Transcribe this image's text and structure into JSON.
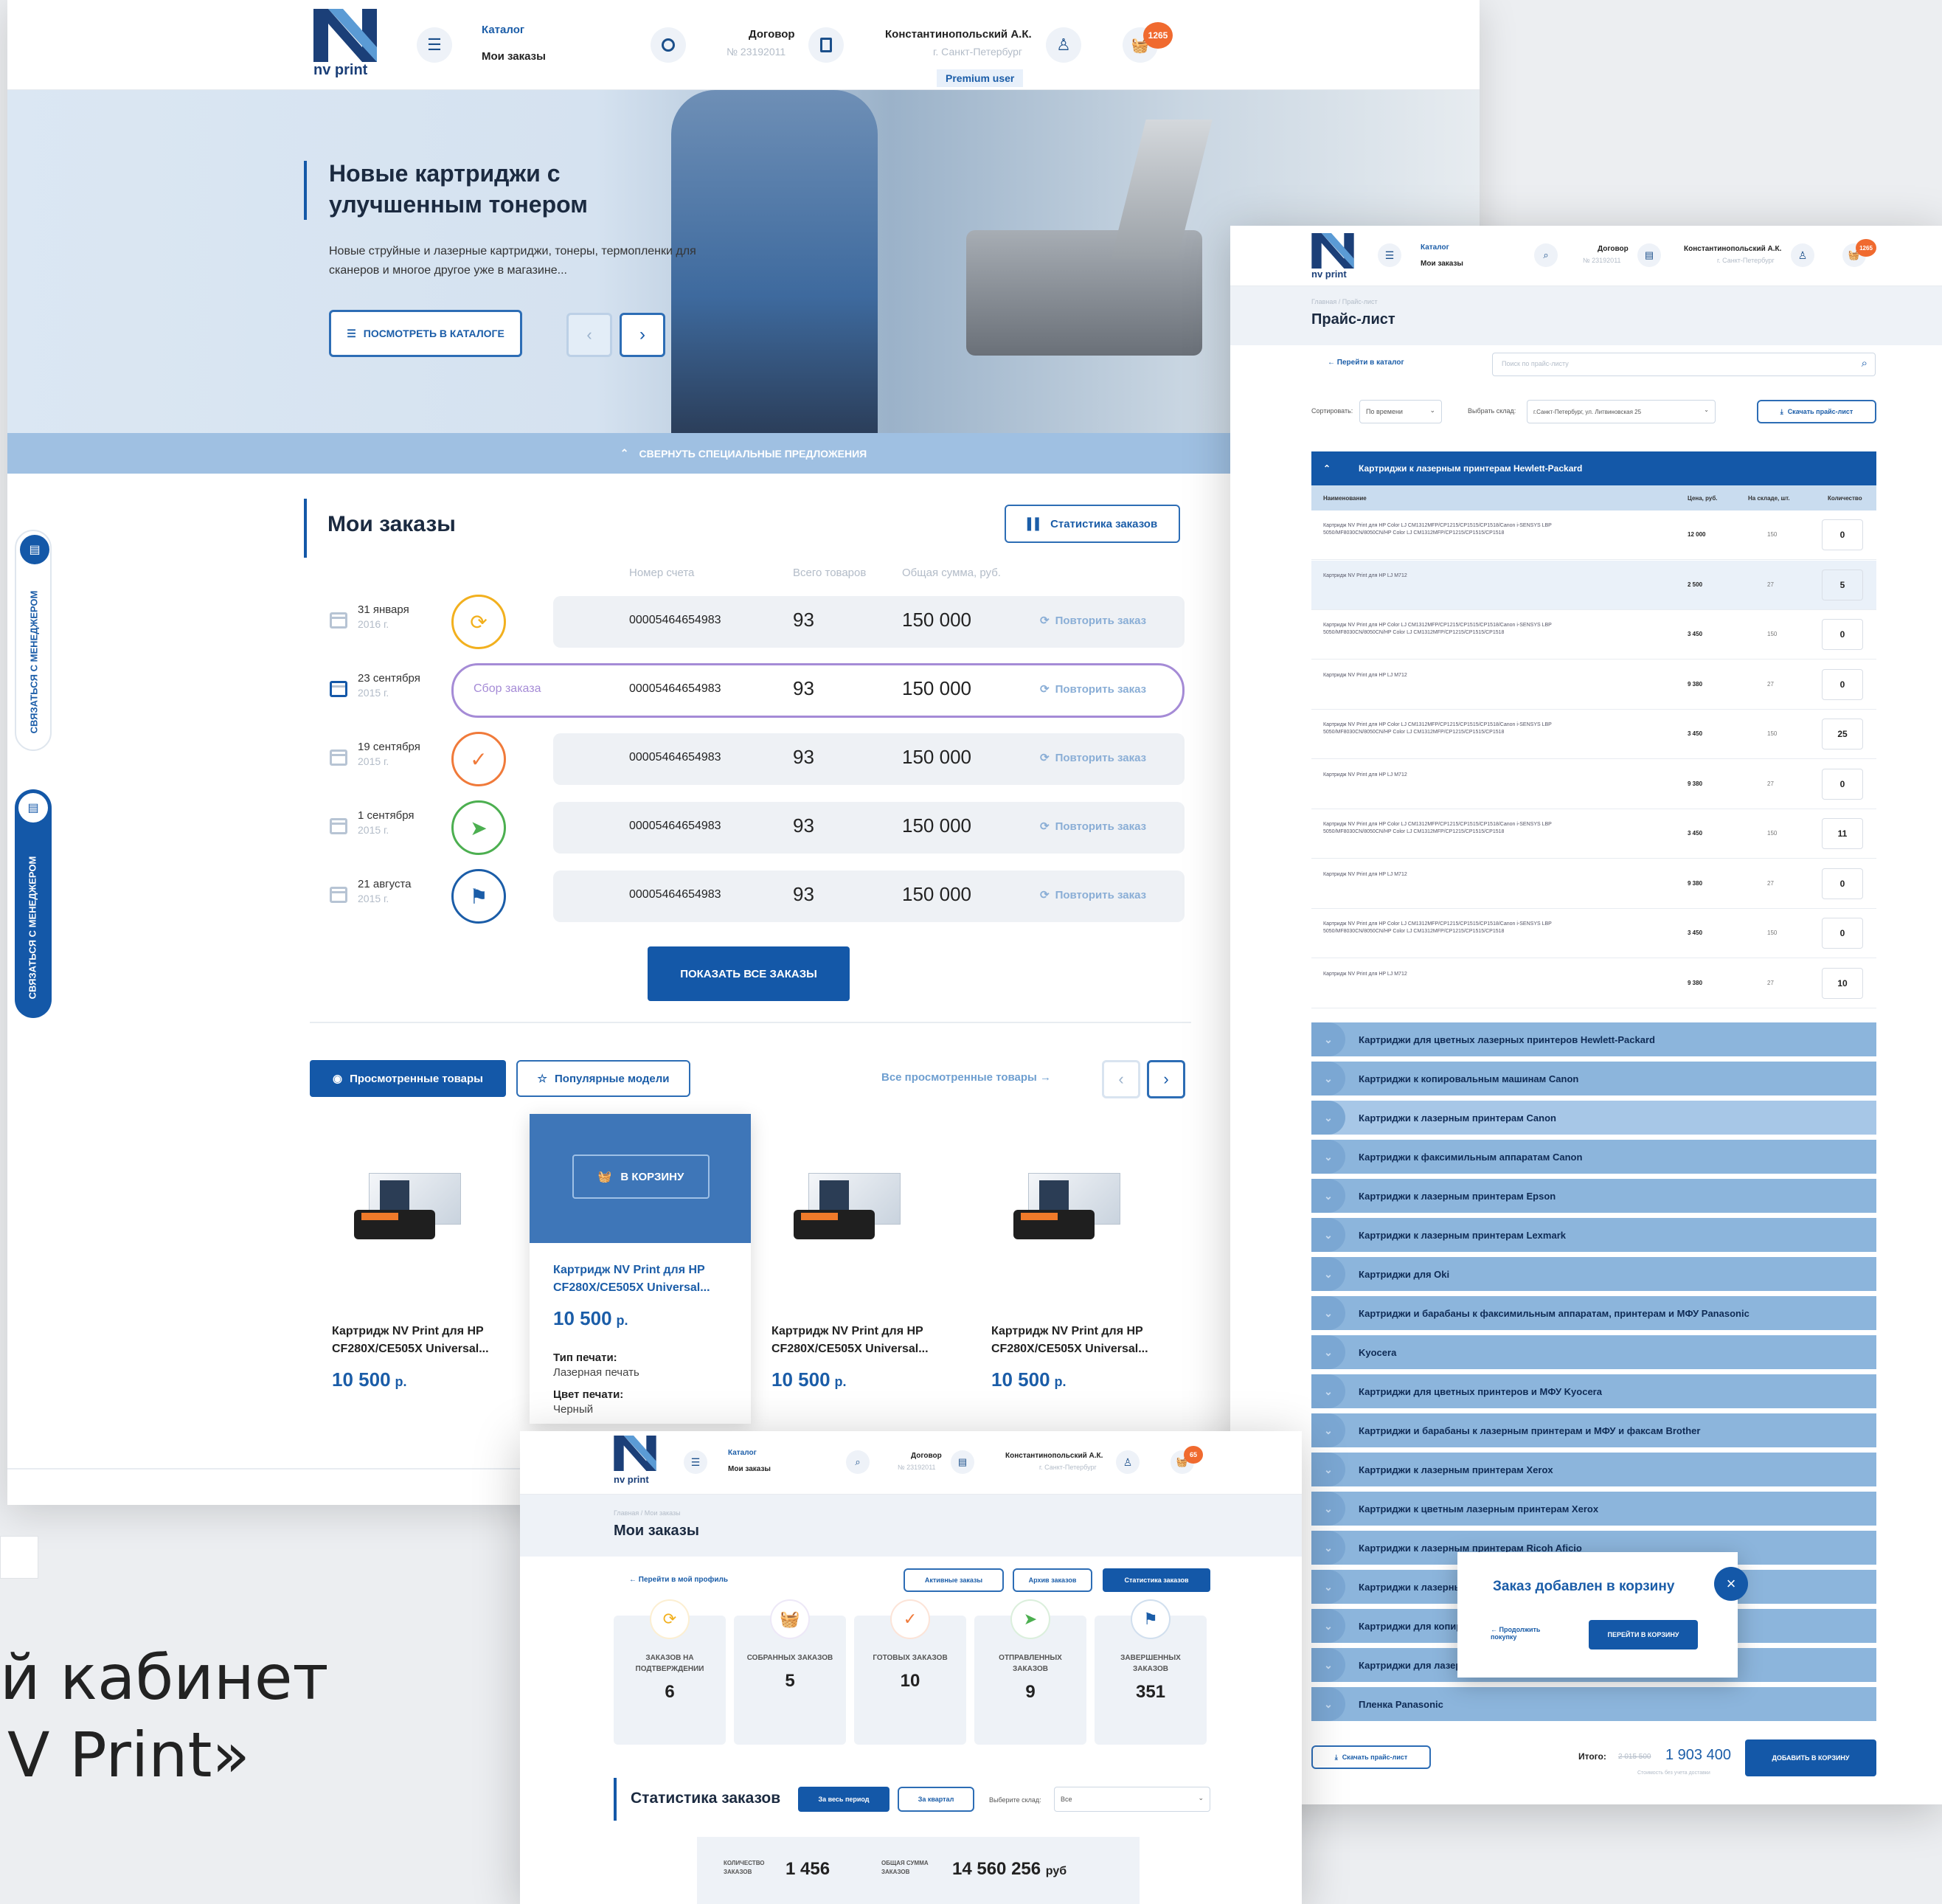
{
  "header": {
    "logo_text": "nv print",
    "nav_catalog": "Каталог",
    "nav_orders": "Мои заказы",
    "contract_label": "Договор",
    "contract_number": "№ 23192011",
    "user_name": "Константинопольский А.К.",
    "user_city": "г. Санкт-Петербург",
    "user_badge": "Premium user",
    "cart_count": "1265"
  },
  "hero": {
    "title": "Новые картриджи с улучшенным тонером",
    "text": "Новые струйные и лазерные картриджи, тонеры, термопленки для сканеров и многое другое уже в магазине...",
    "cta": "ПОСМОТРЕТЬ В КАТАЛОГЕ",
    "collapse": "СВЕРНУТЬ СПЕЦИАЛЬНЫЕ ПРЕДЛОЖЕНИЯ"
  },
  "side_tabs": {
    "contact": "СВЯЗАТЬСЯ С МЕНЕДЖЕРОМ"
  },
  "orders": {
    "title": "Мои заказы",
    "stats_button": "Статистика заказов",
    "columns": [
      "Номер счета",
      "Всего товаров",
      "Общая сумма, руб."
    ],
    "rows": [
      {
        "day": "31 января",
        "year": "2016 г.",
        "status": "",
        "account": "00005464654983",
        "items": "93",
        "sum": "150 000",
        "action": "Повторить заказ",
        "icon": "refresh-icon",
        "color": "#f2b01e"
      },
      {
        "day": "23 сентября",
        "year": "2015 г.",
        "status": "Сбор заказа",
        "account": "00005464654983",
        "items": "93",
        "sum": "150 000",
        "action": "Повторить заказ",
        "icon": "",
        "color": "#a58bd6"
      },
      {
        "day": "19 сентября",
        "year": "2015 г.",
        "status": "",
        "account": "00005464654983",
        "items": "93",
        "sum": "150 000",
        "action": "Повторить заказ",
        "icon": "check-icon",
        "color": "#f07a3a"
      },
      {
        "day": "1 сентября",
        "year": "2015 г.",
        "status": "",
        "account": "00005464654983",
        "items": "93",
        "sum": "150 000",
        "action": "Повторить заказ",
        "icon": "paper-plane-icon",
        "color": "#4caf50"
      },
      {
        "day": "21 августа",
        "year": "2015 г.",
        "status": "",
        "account": "00005464654983",
        "items": "93",
        "sum": "150 000",
        "action": "Повторить заказ",
        "icon": "flag-icon",
        "color": "#1b5da8"
      }
    ],
    "show_all": "ПОКАЗАТЬ ВСЕ ЗАКАЗЫ"
  },
  "viewed": {
    "tab_viewed": "Просмотренные товары",
    "tab_popular": "Популярные модели",
    "all_link": "Все просмотренные товары →",
    "add_to_cart": "В КОРЗИНУ",
    "products": [
      {
        "name": "Картридж NV Print для HP CF280X/CE505X Universal...",
        "price": "10 500",
        "currency": "р."
      },
      {
        "name": "Картридж NV Print для HP CF280X/CE505X Universal...",
        "price": "10 500",
        "currency": "р.",
        "print_type_label": "Тип печати:",
        "print_type": "Лазерная печать",
        "color_label": "Цвет печати:",
        "color": "Черный"
      },
      {
        "name": "Картридж NV Print для HP CF280X/CE505X Universal...",
        "price": "10 500",
        "currency": "р."
      },
      {
        "name": "Картридж NV Print для HP CF280X/CE505X Universal...",
        "price": "10 500",
        "currency": "р."
      }
    ]
  },
  "caption": {
    "line1": "й кабинет",
    "line2": "V Print»"
  },
  "pricelist": {
    "cart_count": "1265",
    "breadcrumb": "Главная / Прайс-лист",
    "title": "Прайс-лист",
    "back": "← Перейти в каталог",
    "search_placeholder": "Поиск по прайс-листу",
    "sort_label": "Сортировать:",
    "sort_value": "По времени",
    "store_label": "Выбрать склад:",
    "store_value": "г.Санкт-Петербург, ул. Литвиновская 25",
    "download": "Скачать прайс-лист",
    "open_category": "Картриджи к лазерным принтерам Hewlett-Packard",
    "columns": [
      "Наименование",
      "Цена, руб.",
      "На складе, шт.",
      "Количество"
    ],
    "rows": [
      {
        "name": "Картридж NV Print для HP Color LJ CM1312MFP/CP1215/CP1515/CP1518/Canon i-SENSYS LBP 5050/MF8030CN/8050CN/HP Color LJ CM1312MFP/CP1215/CP1515/CP1518",
        "price": "12 000",
        "stock": "150",
        "qty": "0"
      },
      {
        "name": "Картридж NV Print для HP LJ M712",
        "price": "2 500",
        "stock": "27",
        "qty": "5"
      },
      {
        "name": "Картридж NV Print для HP Color LJ CM1312MFP/CP1215/CP1515/CP1518/Canon i-SENSYS LBP 5050/MF8030CN/8050CN/HP Color LJ CM1312MFP/CP1215/CP1515/CP1518",
        "price": "3 450",
        "stock": "150",
        "qty": "0"
      },
      {
        "name": "Картридж NV Print для HP LJ M712",
        "price": "9 380",
        "stock": "27",
        "qty": "0"
      },
      {
        "name": "Картридж NV Print для HP Color LJ CM1312MFP/CP1215/CP1515/CP1518/Canon i-SENSYS LBP 5050/MF8030CN/8050CN/HP Color LJ CM1312MFP/CP1215/CP1515/CP1518",
        "price": "3 450",
        "stock": "150",
        "qty": "25"
      },
      {
        "name": "Картридж NV Print для HP LJ M712",
        "price": "9 380",
        "stock": "27",
        "qty": "0"
      },
      {
        "name": "Картридж NV Print для HP Color LJ CM1312MFP/CP1215/CP1515/CP1518/Canon i-SENSYS LBP 5050/MF8030CN/8050CN/HP Color LJ CM1312MFP/CP1215/CP1515/CP1518",
        "price": "3 450",
        "stock": "150",
        "qty": "11"
      },
      {
        "name": "Картридж NV Print для HP LJ M712",
        "price": "9 380",
        "stock": "27",
        "qty": "0"
      },
      {
        "name": "Картридж NV Print для HP Color LJ CM1312MFP/CP1215/CP1515/CP1518/Canon i-SENSYS LBP 5050/MF8030CN/8050CN/HP Color LJ CM1312MFP/CP1215/CP1515/CP1518",
        "price": "3 450",
        "stock": "150",
        "qty": "0"
      },
      {
        "name": "Картридж NV Print для HP LJ M712",
        "price": "9 380",
        "stock": "27",
        "qty": "10"
      }
    ],
    "categories": [
      "Картриджи для цветных лазерных принтеров Hewlett-Packard",
      "Картриджи к копировальным машинам Canon",
      "Картриджи к лазерным принтерам Canon",
      "Картриджи к факсимильным аппаратам Canon",
      "Картриджи к лазерным принтерам Epson",
      "Картриджи к лазерным принтерам Lexmark",
      "Картриджи для Oki",
      "Картриджи и барабаны к факсимильным аппаратам, принтерам и МФУ Panasonic",
      "Kyocera",
      "Картриджи для цветных принтеров и МФУ Kyocera",
      "Картриджи и барабаны к лазерным принтерам и МФУ и факсам Brother",
      "Картриджи к лазерным принтерам Xerox",
      "Картриджи к цветным лазерным принтерам Xerox",
      "Картриджи к лазерным принтерам Ricoh Aficio",
      "Картриджи к лазерны",
      "Картриджи для копир",
      "Картриджи для лазер",
      "Пленка Panasonic"
    ],
    "modal": {
      "title": "Заказ добавлен в корзину",
      "continue": "Продолжить покупку",
      "go_cart": "ПЕРЕЙТИ В КОРЗИНУ",
      "close": "×"
    },
    "footer": {
      "download": "Скачать прайс-лист",
      "total_label": "Итого:",
      "old_total": "2 015 500",
      "total": "1 903 400",
      "note": "Стоимость без учета доставки",
      "add_button": "ДОБАВИТЬ В КОРЗИНУ"
    }
  },
  "stats_page": {
    "cart_count": "65",
    "breadcrumb": "Главная / Мои заказы",
    "title": "Мои заказы",
    "back": "← Перейти в мой профиль",
    "tabs": [
      "Активные заказы",
      "Архив заказов",
      "Статистика заказов"
    ],
    "cards": [
      {
        "label": "ЗАКАЗОВ НА ПОДТВЕРЖДЕНИИ",
        "value": "6",
        "icon": "refresh-icon",
        "color": "#f2b01e"
      },
      {
        "label": "СОБРАННЫХ ЗАКАЗОВ",
        "value": "5",
        "icon": "basket-icon",
        "color": "#a58bd6"
      },
      {
        "label": "ГОТОВЫХ ЗАКАЗОВ",
        "value": "10",
        "icon": "check-icon",
        "color": "#f07a3a"
      },
      {
        "label": "ОТПРАВЛЕННЫХ ЗАКАЗОВ",
        "value": "9",
        "icon": "paper-plane-icon",
        "color": "#4caf50"
      },
      {
        "label": "ЗАВЕРШЕННЫХ ЗАКАЗОВ",
        "value": "351",
        "icon": "flag-icon",
        "color": "#1b5da8"
      }
    ],
    "stats_title": "Статистика заказов",
    "period_all": "За весь период",
    "period_quarter": "За квартал",
    "store_label": "Выберите склад:",
    "store_value": "Все",
    "count_label": "КОЛИЧЕСТВО ЗАКАЗОВ",
    "count_value": "1 456",
    "sum_label": "ОБЩАЯ СУММА ЗАКАЗОВ",
    "sum_value": "14 560 256",
    "sum_unit": "руб"
  },
  "colors": {
    "brand": "#1458a8",
    "brand_light": "#8cb5dc",
    "hero_bg": "#dce8f4",
    "collapse_bar": "#9fc0e2"
  }
}
